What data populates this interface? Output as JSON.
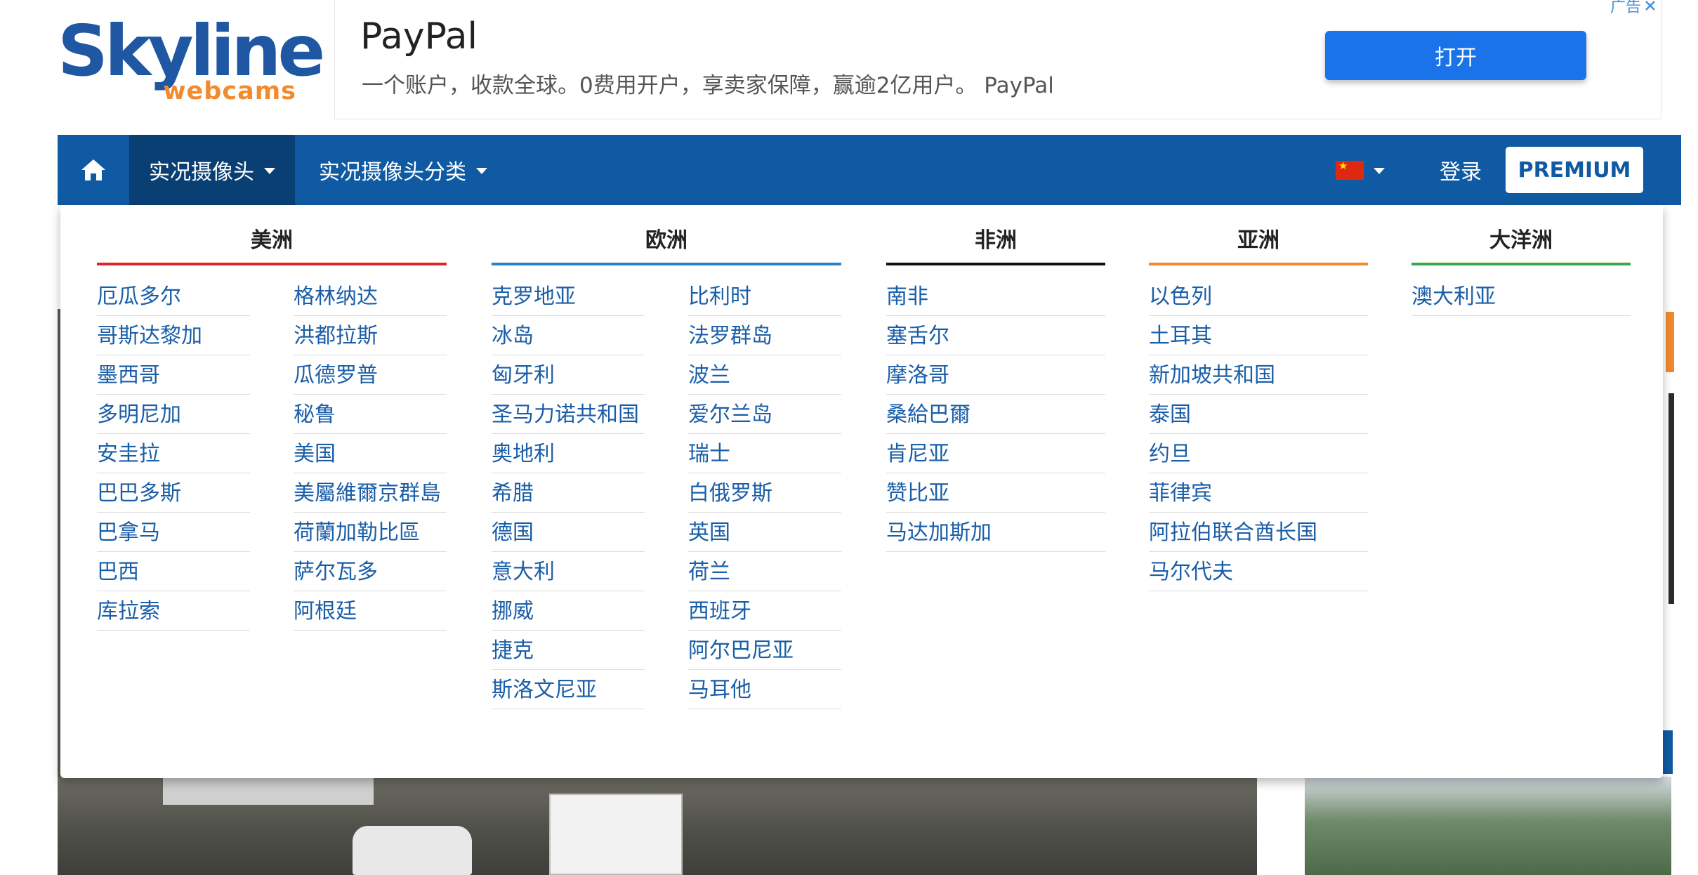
{
  "logo": {
    "main": "Skyline",
    "sub": "webcams"
  },
  "ad": {
    "title": "PayPal",
    "description": "一个账户，收款全球。0费用开户，享卖家保障，赢逾2亿用户。 PayPal",
    "button": "打开",
    "tag": "广告"
  },
  "navbar": {
    "home_icon": "home-icon",
    "live_cams": "实况摄像头",
    "categories": "实况摄像头分类",
    "login": "登录",
    "premium": "PREMIUM",
    "colors": {
      "bar": "#0f5aa3",
      "active": "#0a3f73"
    }
  },
  "menu": {
    "americas": {
      "title": "美洲",
      "color": "#e0262b",
      "col1": [
        "厄瓜多尔",
        "哥斯达黎加",
        "墨西哥",
        "多明尼加",
        "安圭拉",
        "巴巴多斯",
        "巴拿马",
        "巴西",
        "库拉索"
      ],
      "col2": [
        "格林纳达",
        "洪都拉斯",
        "瓜德罗普",
        "秘鲁",
        "美国",
        "美屬維爾京群島",
        "荷蘭加勒比區",
        "萨尔瓦多",
        "阿根廷"
      ]
    },
    "europe": {
      "title": "欧洲",
      "color": "#2a7fc6",
      "col1": [
        "克罗地亚",
        "冰岛",
        "匈牙利",
        "圣马力诺共和国",
        "奥地利",
        "希腊",
        "德国",
        "意大利",
        "挪威",
        "捷克",
        "斯洛文尼亚"
      ],
      "col2": [
        "比利时",
        "法罗群岛",
        "波兰",
        "爱尔兰岛",
        "瑞士",
        "白俄罗斯",
        "英国",
        "荷兰",
        "西班牙",
        "阿尔巴尼亚",
        "马耳他"
      ]
    },
    "africa": {
      "title": "非洲",
      "color": "#111111",
      "col1": [
        "南非",
        "塞舌尔",
        "摩洛哥",
        "桑給巴爾",
        "肯尼亚",
        "赞比亚",
        "马达加斯加"
      ]
    },
    "asia": {
      "title": "亚洲",
      "color": "#f08a2a",
      "col1": [
        "以色列",
        "土耳其",
        "新加坡共和国",
        "泰国",
        "约旦",
        "菲律宾",
        "阿拉伯联合酋长国",
        "马尔代夫"
      ]
    },
    "oceania": {
      "title": "大洋洲",
      "color": "#3aa84a",
      "col1": [
        "澳大利亚"
      ]
    }
  }
}
